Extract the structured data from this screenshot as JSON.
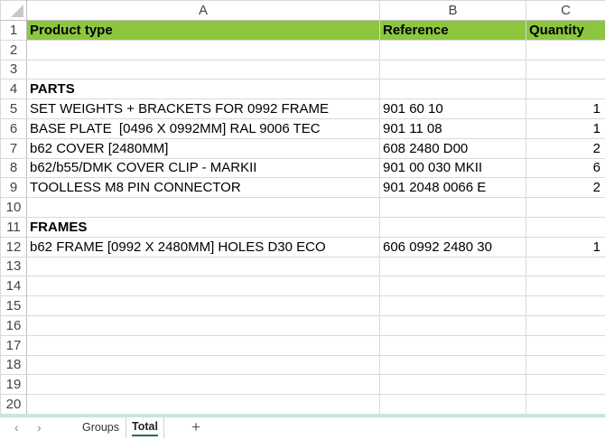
{
  "columns": {
    "headers": [
      "A",
      "B",
      "C"
    ]
  },
  "header_row": {
    "product_type": "Product type",
    "reference": "Reference",
    "quantity": "Quantity"
  },
  "row_numbers": [
    "1",
    "2",
    "3",
    "4",
    "5",
    "6",
    "7",
    "8",
    "9",
    "10",
    "11",
    "12",
    "13",
    "14",
    "15",
    "16",
    "17",
    "18",
    "19",
    "20"
  ],
  "rows": [
    {
      "a": "",
      "b": "",
      "c": ""
    },
    {
      "a": "",
      "b": "",
      "c": ""
    },
    {
      "a": "PARTS",
      "b": "",
      "c": ""
    },
    {
      "a": "SET WEIGHTS + BRACKETS FOR 0992 FRAME",
      "b": "901 60 10",
      "c": "1"
    },
    {
      "a": "BASE PLATE  [0496 X 0992MM] RAL 9006 TEC",
      "b": "901 11 08",
      "c": "1"
    },
    {
      "a": "b62 COVER [2480MM]",
      "b": "608 2480 D00",
      "c": "2"
    },
    {
      "a": "b62/b55/DMK COVER CLIP - MARKII",
      "b": "901 00 030 MKII",
      "c": "6"
    },
    {
      "a": "TOOLLESS M8 PIN CONNECTOR",
      "b": "901 2048 0066 E",
      "c": "2"
    },
    {
      "a": "",
      "b": "",
      "c": ""
    },
    {
      "a": "FRAMES",
      "b": "",
      "c": ""
    },
    {
      "a": "b62 FRAME [0992 X 2480MM] HOLES D30 ECO",
      "b": "606 0992 2480 30",
      "c": "1"
    }
  ],
  "sheet_tabs": {
    "groups": "Groups",
    "total": "Total",
    "add": "+"
  },
  "nav": {
    "prev": "‹",
    "next": "›"
  },
  "colors": {
    "header_fill": "#8cc63f",
    "active_tab_underline": "#217346"
  }
}
